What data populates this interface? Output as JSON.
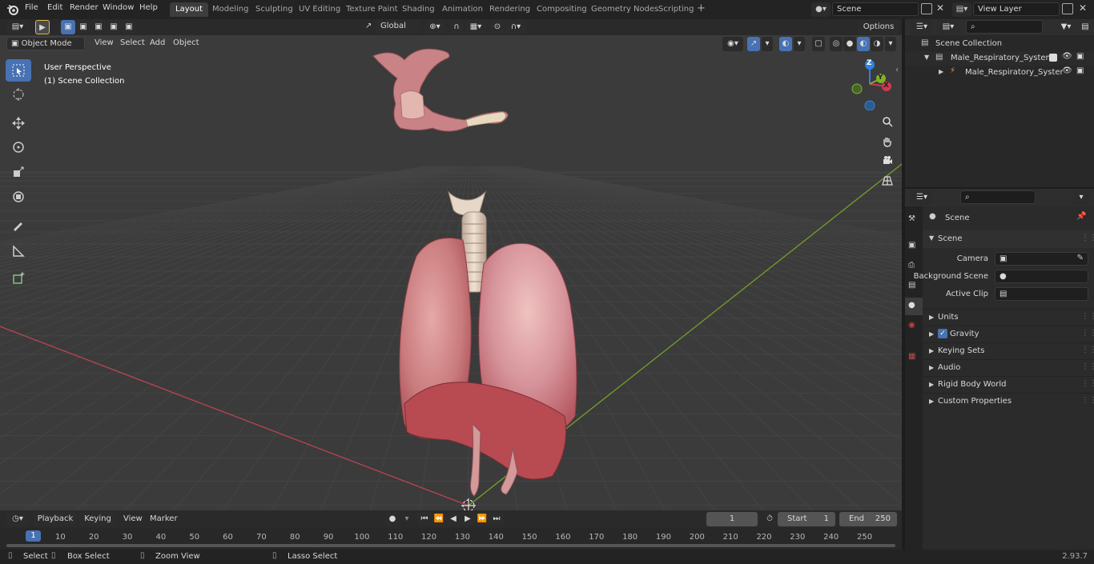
{
  "menubar": {
    "items": [
      "File",
      "Edit",
      "Render",
      "Window",
      "Help"
    ],
    "workspaces": [
      "Layout",
      "Modeling",
      "Sculpting",
      "UV Editing",
      "Texture Paint",
      "Shading",
      "Animation",
      "Rendering",
      "Compositing",
      "Geometry Nodes",
      "Scripting"
    ],
    "add_tab": "+",
    "scene": "Scene",
    "view_layer": "View Layer"
  },
  "viewport_header": {
    "mode": "Object Mode",
    "menus": [
      "View",
      "Select",
      "Add",
      "Object"
    ],
    "transform_orientation": "Global",
    "options": "Options"
  },
  "viewport": {
    "overlay_line1": "User Perspective",
    "overlay_line2": "(1) Scene Collection",
    "gizmo_axes": [
      "Z",
      "Y",
      "X"
    ]
  },
  "outliner": {
    "root": "Scene Collection",
    "collection": "Male_Respiratory_System",
    "object": "Male_Respiratory_Syster"
  },
  "properties": {
    "context": "Scene",
    "section": "Scene",
    "fields": [
      {
        "label": "Camera",
        "icon": "camera-icon"
      },
      {
        "label": "Background Scene",
        "icon": "scene-icon"
      },
      {
        "label": "Active Clip",
        "icon": "clip-icon"
      }
    ],
    "subpanels": [
      "Units",
      "Gravity",
      "Keying Sets",
      "Audio",
      "Rigid Body World",
      "Custom Properties"
    ],
    "gravity_checked": true
  },
  "timeline": {
    "menus": [
      "Playback",
      "Keying",
      "View",
      "Marker"
    ],
    "current_frame": "1",
    "start_label": "Start",
    "start_value": "1",
    "end_label": "End",
    "end_value": "250",
    "ticks": [
      "10",
      "20",
      "30",
      "40",
      "50",
      "60",
      "70",
      "80",
      "90",
      "100",
      "110",
      "120",
      "130",
      "140",
      "150",
      "160",
      "170",
      "180",
      "190",
      "200",
      "210",
      "220",
      "230",
      "240",
      "250"
    ],
    "playhead": "1"
  },
  "statusbar": {
    "items": [
      "Select",
      "Box Select",
      "Zoom View",
      "Lasso Select"
    ],
    "version": "2.93.7"
  },
  "colors": {
    "accent": "#4772b3",
    "x_axis": "#d1394f",
    "y_axis": "#7fb02c",
    "z_axis": "#2f83e3",
    "viewport_bg": "#3b3b3b"
  }
}
